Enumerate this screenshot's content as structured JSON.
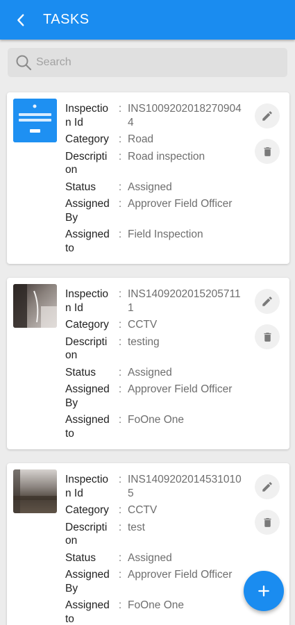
{
  "app": {
    "title": "TASKS",
    "accent": "#1a8cf0"
  },
  "search": {
    "placeholder": "Search"
  },
  "tasks": [
    {
      "thumbnail": "app-screenshot",
      "inspection_id_label": "Inspection Id",
      "inspection_id": "INS10092020182709044",
      "category_label": "Category",
      "category": "Road",
      "description_label": "Description",
      "description": "Road inspection",
      "status_label": "Status",
      "status": "Assigned",
      "assigned_by_label": "Assigned By",
      "assigned_by": "Approver Field Officer",
      "assigned_to_label": "Assigned to",
      "assigned_to": "Field Inspection"
    },
    {
      "thumbnail": "photo-cctv-1",
      "inspection_id_label": "Inspection Id",
      "inspection_id": "INS14092020152057111",
      "category_label": "Category",
      "category": "CCTV",
      "description_label": "Description",
      "description": "testing",
      "status_label": "Status",
      "status": "Assigned",
      "assigned_by_label": "Assigned By",
      "assigned_by": "Approver Field Officer",
      "assigned_to_label": "Assigned to",
      "assigned_to": "FoOne One"
    },
    {
      "thumbnail": "photo-cctv-2",
      "inspection_id_label": "Inspection Id",
      "inspection_id": "INS14092020145310105",
      "category_label": "Category",
      "category": "CCTV",
      "description_label": "Description",
      "description": "test",
      "status_label": "Status",
      "status": "Assigned",
      "assigned_by_label": "Assigned By",
      "assigned_by": "Approver Field Officer",
      "assigned_to_label": "Assigned to",
      "assigned_to": "FoOne One"
    }
  ],
  "icons": {
    "back": "chevron-left-icon",
    "search": "search-icon",
    "edit": "pencil-icon",
    "delete": "trash-icon",
    "add": "plus-icon"
  }
}
